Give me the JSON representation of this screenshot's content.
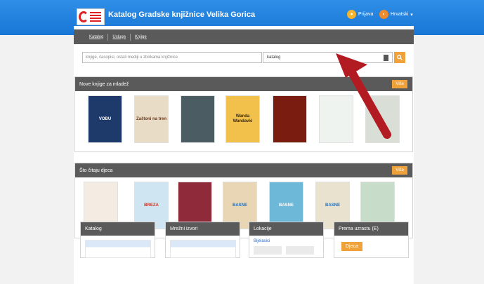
{
  "header": {
    "site_title": "Katalog Gradske knjižnice Velika Gorica",
    "login_label": "Prijava",
    "language_label": "Hrvatski",
    "colors": {
      "bar": "#1876d6",
      "accent": "#f0a23a"
    }
  },
  "nav": {
    "items": [
      {
        "label": "Katalog"
      },
      {
        "label": "Usluge"
      },
      {
        "label": "Knjige"
      }
    ]
  },
  "search": {
    "placeholder": "knjige, časopisi, ostali mediji u zbirkama knjižnice",
    "scope_value": "katalog",
    "search_icon": "search-icon"
  },
  "sections": [
    {
      "title": "Nove knjige za mladež",
      "more_label": "Više",
      "books": [
        {
          "title": "VOĐU",
          "color": "#1d3a6b",
          "text_color": "#ffffff"
        },
        {
          "title": "Zaštoni na tren",
          "color": "#e8dcc6",
          "text_color": "#6a3a20"
        },
        {
          "title": "",
          "color": "#4b5d62",
          "text_color": "#ffffff"
        },
        {
          "title": "Wanda Wandavić",
          "color": "#f2c14b",
          "text_color": "#3b2a10"
        },
        {
          "title": "",
          "color": "#7a1c10",
          "text_color": "#ffd27a"
        },
        {
          "title": "",
          "color": "#eef3f0",
          "text_color": "#2c6a3a"
        },
        {
          "title": "",
          "color": "#d9dfd6",
          "text_color": "#333333"
        }
      ]
    },
    {
      "title": "Što čitaju djeca",
      "more_label": "Više",
      "books": [
        {
          "title": "",
          "color": "#f4ece2",
          "text_color": "#c0392b"
        },
        {
          "title": "BREZA",
          "color": "#cfe6f2",
          "text_color": "#c0392b"
        },
        {
          "title": "",
          "color": "#8e2a3a",
          "text_color": "#ffffff"
        },
        {
          "title": "BASNE",
          "color": "#e8d6b5",
          "text_color": "#2a6fb0"
        },
        {
          "title": "BASNE",
          "color": "#6db7d9",
          "text_color": "#ffffff"
        },
        {
          "title": "BASNE",
          "color": "#e9e2cf",
          "text_color": "#2a6fb0"
        },
        {
          "title": "",
          "color": "#c7dcc9",
          "text_color": "#333333"
        }
      ]
    }
  ],
  "cards": [
    {
      "title": "Katalog"
    },
    {
      "title": "Mrežni izvori"
    },
    {
      "title": "Lokacije",
      "link_text": "Bijelasici"
    },
    {
      "title": "Prema uzrastu (E)",
      "button_label": "Djeca"
    }
  ]
}
